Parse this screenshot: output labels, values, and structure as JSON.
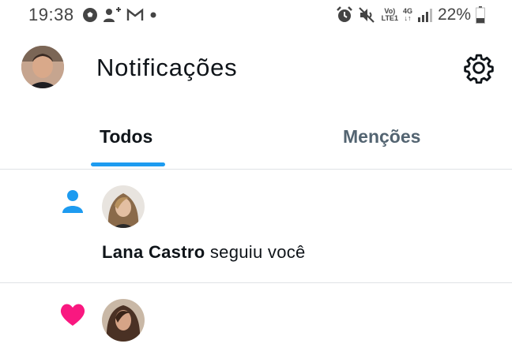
{
  "status_bar": {
    "time": "19:38",
    "battery_percent": "22%",
    "network_top": "Vo)",
    "network_bottom": "LTE1",
    "network_gen": "4G",
    "icons": [
      "soccer-ball-icon",
      "add-user-icon",
      "gmail-icon",
      "dot-icon",
      "alarm-icon",
      "mute-icon",
      "signal-icon",
      "battery-icon"
    ]
  },
  "header": {
    "title": "Notificações"
  },
  "tabs": [
    {
      "label": "Todos",
      "selected": true
    },
    {
      "label": "Menções",
      "selected": false
    }
  ],
  "notifications": [
    {
      "type": "follow",
      "icon": "person-icon",
      "user": "Lana Castro",
      "action": "seguiu você"
    },
    {
      "type": "like",
      "icon": "heart-icon"
    }
  ],
  "colors": {
    "accent": "#1d9bf0",
    "like": "#f91880",
    "text": "#0f1419",
    "muted": "#536471",
    "divider": "#dfe3e6"
  }
}
